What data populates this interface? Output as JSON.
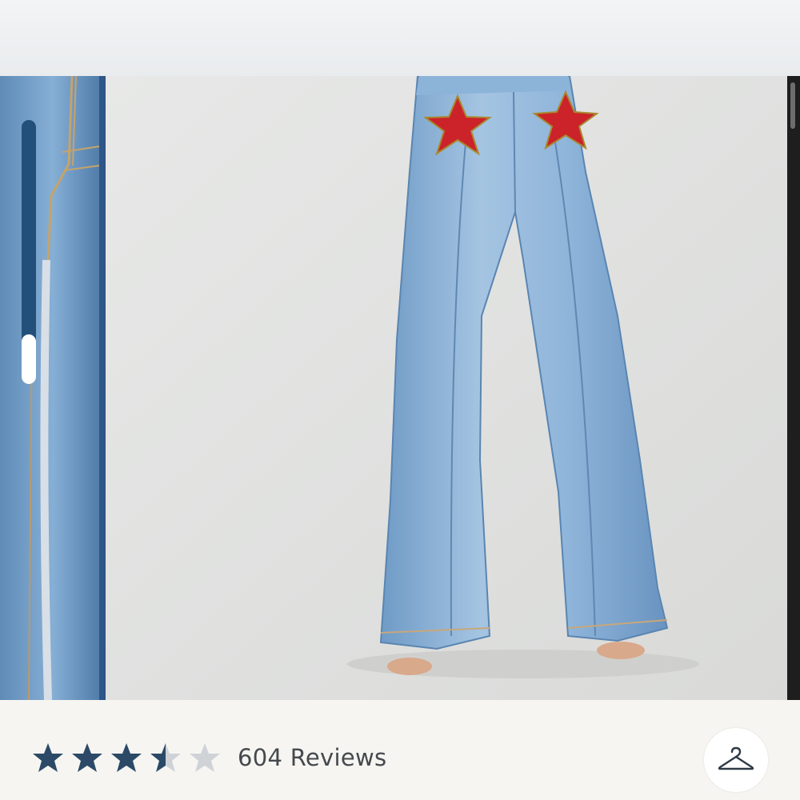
{
  "product": {
    "rating": 3.5,
    "rating_max": 5,
    "reviews_label": "604 Reviews"
  },
  "icons": {
    "hanger": "hanger-icon",
    "star": "star-icon"
  },
  "colors": {
    "star_filled": "#2c4a67",
    "star_empty": "#cfd3d7",
    "denim": "#7aa5cf",
    "star_patch": "#cc2229",
    "scroll_indicator": "#23507a"
  }
}
